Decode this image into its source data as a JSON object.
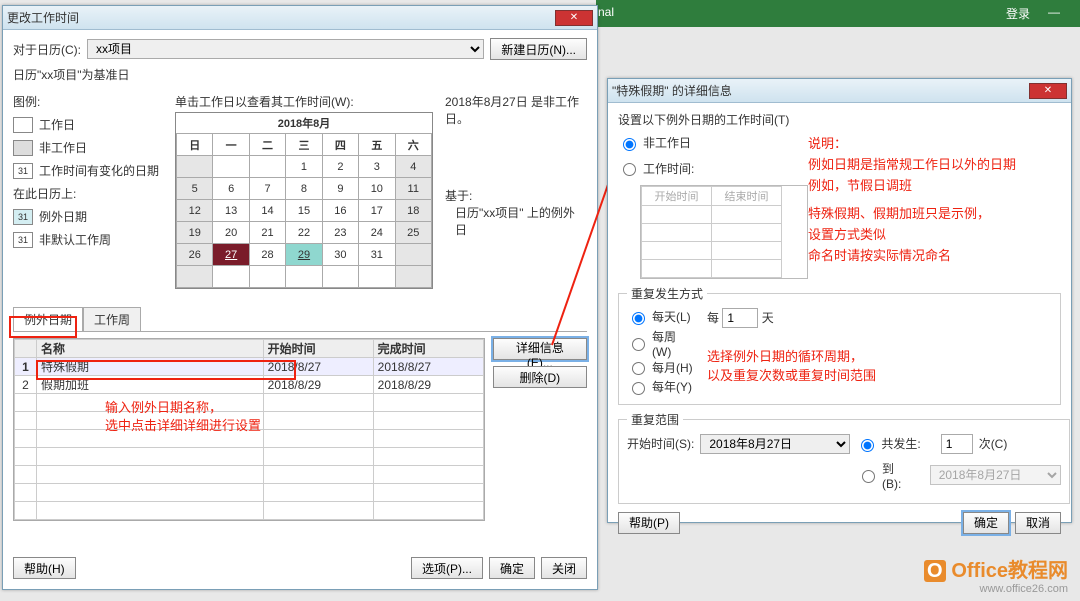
{
  "greenbar": {
    "center": "nal",
    "login": "登录",
    "dash": "—"
  },
  "win1": {
    "title": "更改工作时间",
    "calLabel": "对于日历(C):",
    "calValue": "xx项目",
    "newCal": "新建日历(N)...",
    "baseLine": "日历\"xx项目\"为基准日",
    "legend": {
      "title": "图例:",
      "workday": "工作日",
      "nonworkday": "非工作日",
      "changed": "工作时间有变化的日期",
      "onThis": "在此日历上:",
      "exception": "例外日期",
      "customWeek": "非默认工作周"
    },
    "clickHint": "单击工作日以查看其工作时间(W):",
    "calTitle": "2018年8月",
    "dow": [
      "日",
      "一",
      "二",
      "三",
      "四",
      "五",
      "六"
    ],
    "infoLine": "2018年8月27日 是非工作日。",
    "basedOn": "基于:",
    "basedOnVal": "日历\"xx项目\" 上的例外日",
    "tabs": {
      "exc": "例外日期",
      "week": "工作周"
    },
    "cols": {
      "name": "名称",
      "start": "开始时间",
      "end": "完成时间"
    },
    "rows": [
      {
        "n": "1",
        "name": "特殊假期",
        "start": "2018/8/27",
        "end": "2018/8/27"
      },
      {
        "n": "2",
        "name": "假期加班",
        "start": "2018/8/29",
        "end": "2018/8/29"
      }
    ],
    "detailBtn": "详细信息(E)...",
    "deleteBtn": "删除(D)",
    "help": "帮助(H)",
    "options": "选项(P)...",
    "ok": "确定",
    "cancel": "关闭",
    "redNote1": "输入例外日期名称，",
    "redNote2": "选中点击详细详细进行设置"
  },
  "win2": {
    "title": "\"特殊假期\" 的详细信息",
    "setLine": "设置以下例外日期的工作时间(T)",
    "nonWork": "非工作日",
    "workTime": "工作时间:",
    "gridCols": {
      "start": "开始时间",
      "end": "结束时间"
    },
    "note": {
      "t": "说明：",
      "l1": "例如日期是指常规工作日以外的日期",
      "l2": "例如，节假日调班",
      "l3": "特殊假期、假期加班只是示例，",
      "l4": "设置方式类似",
      "l5": "命名时请按实际情况命名"
    },
    "recurTitle": "重复发生方式",
    "daily": "每天(L)",
    "weekly": "每周(W)",
    "monthly": "每月(H)",
    "yearly": "每年(Y)",
    "every": "每",
    "everyVal": "1",
    "unit": "天",
    "recurNote1": "选择例外日期的循环周期，",
    "recurNote2": "以及重复次数或重复时间范围",
    "rangeTitle": "重复范围",
    "startLabel": "开始时间(S):",
    "startVal": "2018年8月27日",
    "occurLabel": "共发生:",
    "occurVal": "1",
    "occurUnit": "次(C)",
    "untilLabel": "到(B):",
    "untilVal": "2018年8月27日",
    "help": "帮助(P)",
    "ok": "确定",
    "cancel": "取消"
  },
  "watermark": {
    "brand": "Office教程网",
    "url": "www.office26.com"
  }
}
